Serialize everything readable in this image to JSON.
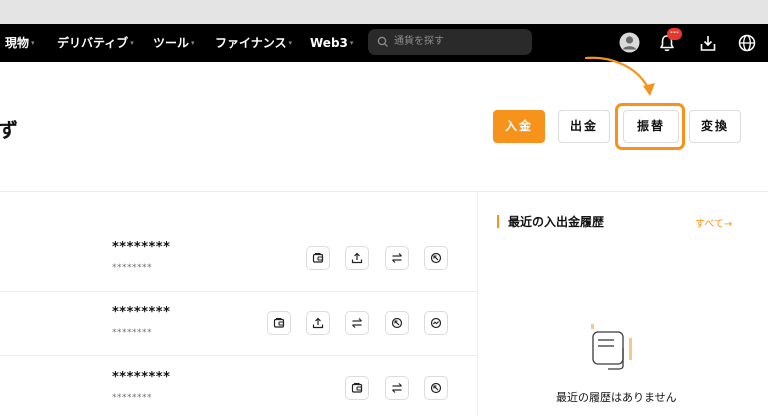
{
  "nav": {
    "items": [
      {
        "label": "現物",
        "caret": "▾"
      },
      {
        "label": "デリバティブ",
        "caret": "▾"
      },
      {
        "label": "ツール",
        "caret": "▾"
      },
      {
        "label": "ファイナンス",
        "caret": "▾"
      },
      {
        "label": "Web3",
        "caret": "▾"
      }
    ],
    "search_placeholder": "通貨を探す",
    "notification_badge": "···"
  },
  "header": {
    "title_fragment": "ず"
  },
  "actions": {
    "deposit": "入金",
    "withdraw": "出金",
    "transfer": "振替",
    "convert": "変換"
  },
  "accounts": [
    {
      "balance": "********",
      "sub": "********",
      "buttons": [
        "wallet-icon",
        "upload-icon",
        "swap-icon",
        "refresh-icon"
      ]
    },
    {
      "balance": "********",
      "sub": "********",
      "buttons": [
        "wallet-icon",
        "upload-icon",
        "swap-icon",
        "refresh-icon",
        "trend-icon"
      ]
    },
    {
      "balance": "********",
      "sub": "********",
      "buttons": [
        "wallet-icon",
        "swap-icon",
        "refresh-icon"
      ]
    }
  ],
  "history": {
    "title": "最近の入出金履歴",
    "see_all": "すべて",
    "see_all_arrow": "→",
    "empty_text": "最近の履歴はありません"
  },
  "colors": {
    "accent": "#f7931a",
    "nav_bg": "#000000",
    "badge": "#e8372c"
  }
}
